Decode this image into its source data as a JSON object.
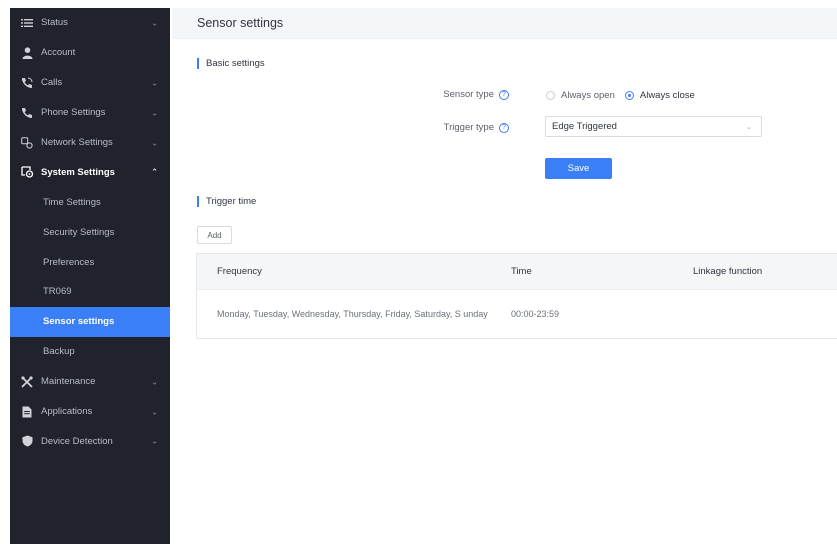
{
  "sidebar": {
    "items": [
      {
        "label": "Status",
        "icon": "list-icon",
        "chevron": "⌄"
      },
      {
        "label": "Account",
        "icon": "user-icon",
        "chevron": ""
      },
      {
        "label": "Calls",
        "icon": "call-icon",
        "chevron": "⌄"
      },
      {
        "label": "Phone Settings",
        "icon": "phone-icon",
        "chevron": "⌄"
      },
      {
        "label": "Network Settings",
        "icon": "network-icon",
        "chevron": "⌄"
      },
      {
        "label": "System Settings",
        "icon": "system-settings-icon",
        "chevron": "⌃"
      }
    ],
    "sub_items": [
      {
        "label": "Time Settings"
      },
      {
        "label": "Security Settings"
      },
      {
        "label": "Preferences"
      },
      {
        "label": "TR069"
      },
      {
        "label": "Sensor settings"
      },
      {
        "label": "Backup"
      }
    ],
    "bottom_items": [
      {
        "label": "Maintenance",
        "icon": "tools-icon",
        "chevron": "⌄"
      },
      {
        "label": "Applications",
        "icon": "document-icon",
        "chevron": "⌄"
      },
      {
        "label": "Device Detection",
        "icon": "shield-icon",
        "chevron": "⌄"
      }
    ],
    "active_color": "#3a7ff6"
  },
  "main": {
    "title": "Sensor settings",
    "basic_section": "Basic settings",
    "sensor_type": {
      "label": "Sensor type",
      "help": "?",
      "options": [
        "Always open",
        "Always close"
      ],
      "selected": "Always close"
    },
    "trigger_type": {
      "label": "Trigger type",
      "help": "?",
      "value": "Edge Triggered",
      "arrow": "⌄"
    },
    "save_label": "Save",
    "trigger_section": "Trigger time",
    "add_label": "Add",
    "table": {
      "headers": [
        "Frequency",
        "Time",
        "Linkage function"
      ],
      "rows": [
        {
          "frequency": "Monday, Tuesday, Wednesday, Thursday, Friday, Saturday, S unday",
          "time": "00:00-23:59",
          "linkage": ""
        }
      ]
    }
  }
}
